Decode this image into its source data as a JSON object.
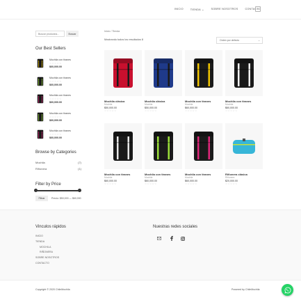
{
  "header": {
    "nav": [
      "INICIO",
      "TIENDA",
      "SOBRE NOSOTROS",
      "CONTACTO"
    ],
    "tienda_chevron": "⌄",
    "cart_count": "0"
  },
  "sidebar": {
    "search_placeholder": "Buscar productos...",
    "search_button": "Buscar",
    "best_sellers_title": "Our Best Sellers",
    "best_sellers": [
      {
        "name": "Mochila con tiranes",
        "stars": "☆☆☆☆☆",
        "price": "$60,000.00"
      },
      {
        "name": "Mochila con tiranes",
        "stars": "☆☆☆☆☆",
        "price": "$60,000.00"
      },
      {
        "name": "Mochila con tiranes",
        "stars": "☆☆☆☆☆",
        "price": "$60,000.00"
      },
      {
        "name": "Mochila con tiranes",
        "stars": "☆☆☆☆☆",
        "price": "$60,000.00"
      },
      {
        "name": "Mochila con tiranes",
        "stars": "☆☆☆☆☆",
        "price": "$60,000.00"
      }
    ],
    "categories_title": "Browse by Categories",
    "categories": [
      {
        "name": "Mochila",
        "count": "(7)"
      },
      {
        "name": "Riñonera",
        "count": "(1)"
      }
    ],
    "filter_title": "Filter by Price",
    "filter_button": "Filtrar",
    "price_range": "Precio: $50,000 — $60,000"
  },
  "main": {
    "breadcrumb": "Inicio / Tienda",
    "result_count": "Mostrando todos los resultados 8",
    "orderby": "Orden por defecto",
    "orderby_chevron": "⌄",
    "products": [
      {
        "title": "Mochila clásica",
        "category": "Mochila",
        "price": "$50,000.00",
        "stars": "☆☆☆☆☆",
        "color": "#c8102e",
        "strap": "#1a1a1a"
      },
      {
        "title": "Mochila clásica",
        "category": "Mochila",
        "price": "$50,000.00",
        "stars": "☆☆☆☆☆",
        "color": "#1f3a8a",
        "strap": "#1a1a1a"
      },
      {
        "title": "Mochila con tiranes",
        "category": "Mochila",
        "price": "$60,000.00",
        "stars": "☆☆☆☆☆",
        "color": "#1a1a1a",
        "strap": "#f2c500"
      },
      {
        "title": "Mochila con tiranes",
        "category": "Mochila",
        "price": "$60,000.00",
        "stars": "☆☆☆☆☆",
        "color": "#1a1a1a",
        "strap": "#f2f2f2"
      },
      {
        "title": "Mochila con tiranes",
        "category": "Mochila",
        "price": "$60,000.00",
        "stars": "☆☆☆☆☆",
        "color": "#1a1a1a",
        "strap": "#e8e8e8"
      },
      {
        "title": "Mochila con tiranes",
        "category": "Mochila",
        "price": "$60,000.00",
        "stars": "☆☆☆☆☆",
        "color": "#1a1a1a",
        "strap": "#9ce03a"
      },
      {
        "title": "Mochila con tiranes",
        "category": "Mochila",
        "price": "$60,000.00",
        "stars": "☆☆☆☆☆",
        "color": "#1a1a1a",
        "strap": "#e0267a"
      },
      {
        "title": "Riñonera clásica",
        "category": "Riñonera",
        "price": "$20,000.00",
        "stars": "☆☆☆☆☆",
        "color": "#37b6d8",
        "strap": "#c8e03a"
      }
    ]
  },
  "footer": {
    "quick_links_title": "Vinculos rápidos",
    "quick_links": [
      {
        "label": "INICIO",
        "sub": false
      },
      {
        "label": "TIENDA",
        "sub": false
      },
      {
        "label": "MOCHILA",
        "sub": true
      },
      {
        "label": "RIÑONERA",
        "sub": true
      },
      {
        "label": "SOBRE NOSOTROS",
        "sub": false
      },
      {
        "label": "CONTACTO",
        "sub": false
      }
    ],
    "social_title": "Nuestras redes sociales",
    "copyright": "Copyright © 2020 ChileMochila",
    "powered_by": "Powered by ChileMochila"
  },
  "colors": {
    "accent": "#333333",
    "whatsapp": "#25d366"
  }
}
